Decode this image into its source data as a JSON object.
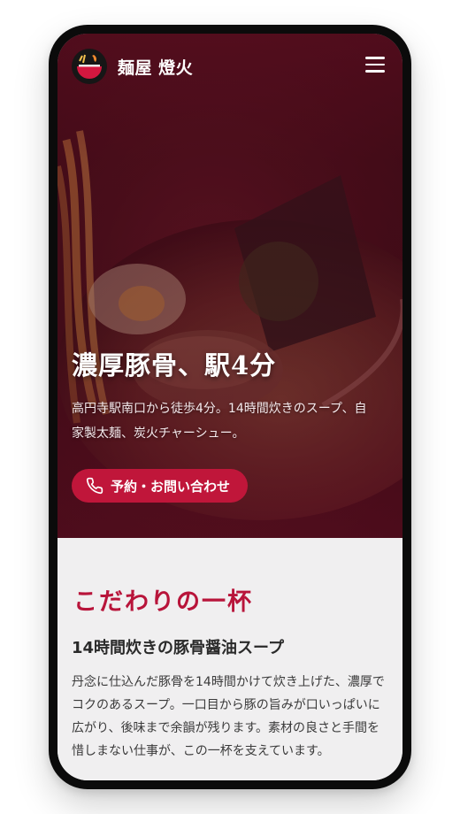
{
  "header": {
    "brand": "麺屋 燈火",
    "logo_icon": "ramen-bowl-logo",
    "menu_icon": "hamburger-menu-icon"
  },
  "hero": {
    "title": "濃厚豚骨、駅4分",
    "subtitle": "高円寺駅南口から徒歩4分。14時間炊きのスープ、自家製太麺、炭火チャーシュー。",
    "cta_label": "予約・お問い合わせ",
    "cta_icon": "phone-icon"
  },
  "section": {
    "title": "こだわりの一杯",
    "subtitle": "14時間炊きの豚骨醤油スープ",
    "body": "丹念に仕込んだ豚骨を14時間かけて炊き上げた、濃厚でコクのあるスープ。一口目から豚の旨みが口いっぱいに広がり、後味まで余韻が残ります。素材の良さと手間を惜しまない仕事が、この一杯を支えています。"
  },
  "colors": {
    "accent": "#c0163a",
    "section_title": "#b8143a",
    "hero_tint": "#5c0e20",
    "content_bg": "#f0eff0"
  }
}
